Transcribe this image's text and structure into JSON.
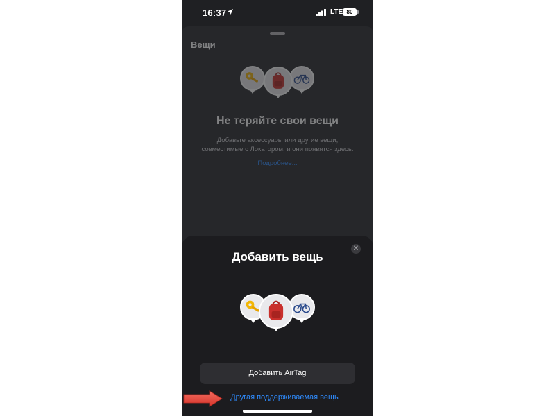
{
  "status_bar": {
    "time": "16:37",
    "network": "LTE",
    "battery": "80"
  },
  "background_screen": {
    "title": "Вещи",
    "heading": "Не теряйте свои вещи",
    "description": "Добавьте аксессуары или другие вещи, совместимые с Локатором, и они появятся здесь.",
    "link": "Подробнее..."
  },
  "modal": {
    "title": "Добавить вещь",
    "close_symbol": "✕",
    "primary_button": "Добавить AirTag",
    "secondary_link": "Другая поддерживаемая вещь"
  },
  "icons": [
    "location-arrow-icon",
    "signal-bars-icon",
    "battery-icon",
    "key-icon",
    "backpack-icon",
    "bicycle-icon",
    "close-icon",
    "red-arrow-icon"
  ],
  "colors": {
    "link_blue": "#2f8cff",
    "annotation_red": "#e8443a"
  }
}
